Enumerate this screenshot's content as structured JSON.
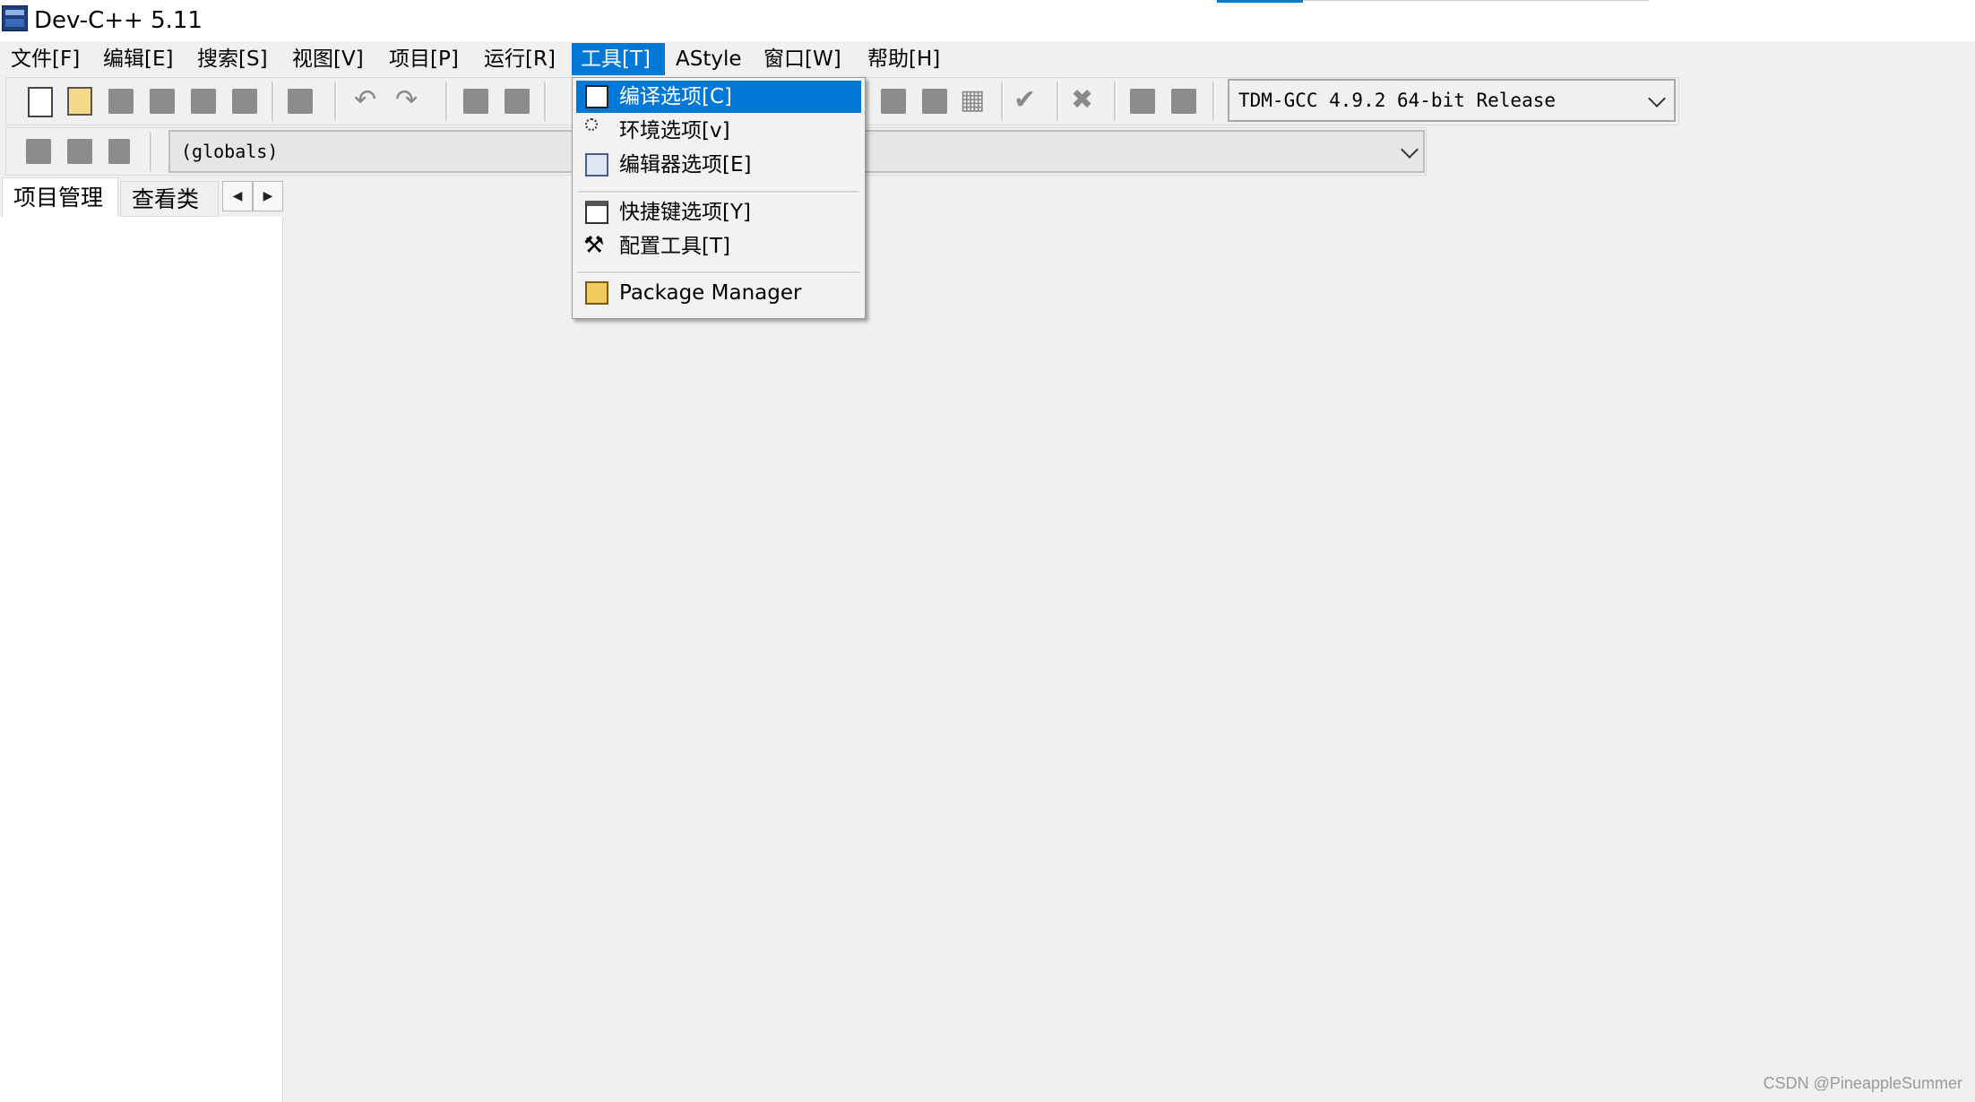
{
  "window": {
    "title": "Dev-C++ 5.11"
  },
  "menubar": {
    "items": [
      "文件[F]",
      "编辑[E]",
      "搜索[S]",
      "视图[V]",
      "项目[P]",
      "运行[R]",
      "工具[T]",
      "AStyle",
      "窗口[W]",
      "帮助[H]"
    ],
    "active": "工具[T]"
  },
  "tools_menu": {
    "items": [
      {
        "label": "编译选项[C]",
        "icon": "compiler-options-icon",
        "highlighted": true
      },
      {
        "label": "环境选项[v]",
        "icon": "environment-options-icon"
      },
      {
        "label": "编辑器选项[E]",
        "icon": "editor-options-icon"
      },
      {
        "label": "快捷键选项[Y]",
        "icon": "shortcut-options-icon"
      },
      {
        "label": "配置工具[T]",
        "icon": "hammer-icon"
      },
      {
        "label": "Package Manager",
        "icon": "package-icon"
      }
    ]
  },
  "toolbar": {
    "compiler": "TDM-GCC 4.9.2 64-bit Release"
  },
  "class_browser": {
    "scope": "(globals)"
  },
  "left_panel": {
    "tabs": [
      "项目管理",
      "查看类"
    ],
    "active_tab": "项目管理"
  },
  "watermark": "CSDN @PineappleSummer",
  "colors": {
    "accent": "#0078d7",
    "background": "#f0f0f0"
  }
}
